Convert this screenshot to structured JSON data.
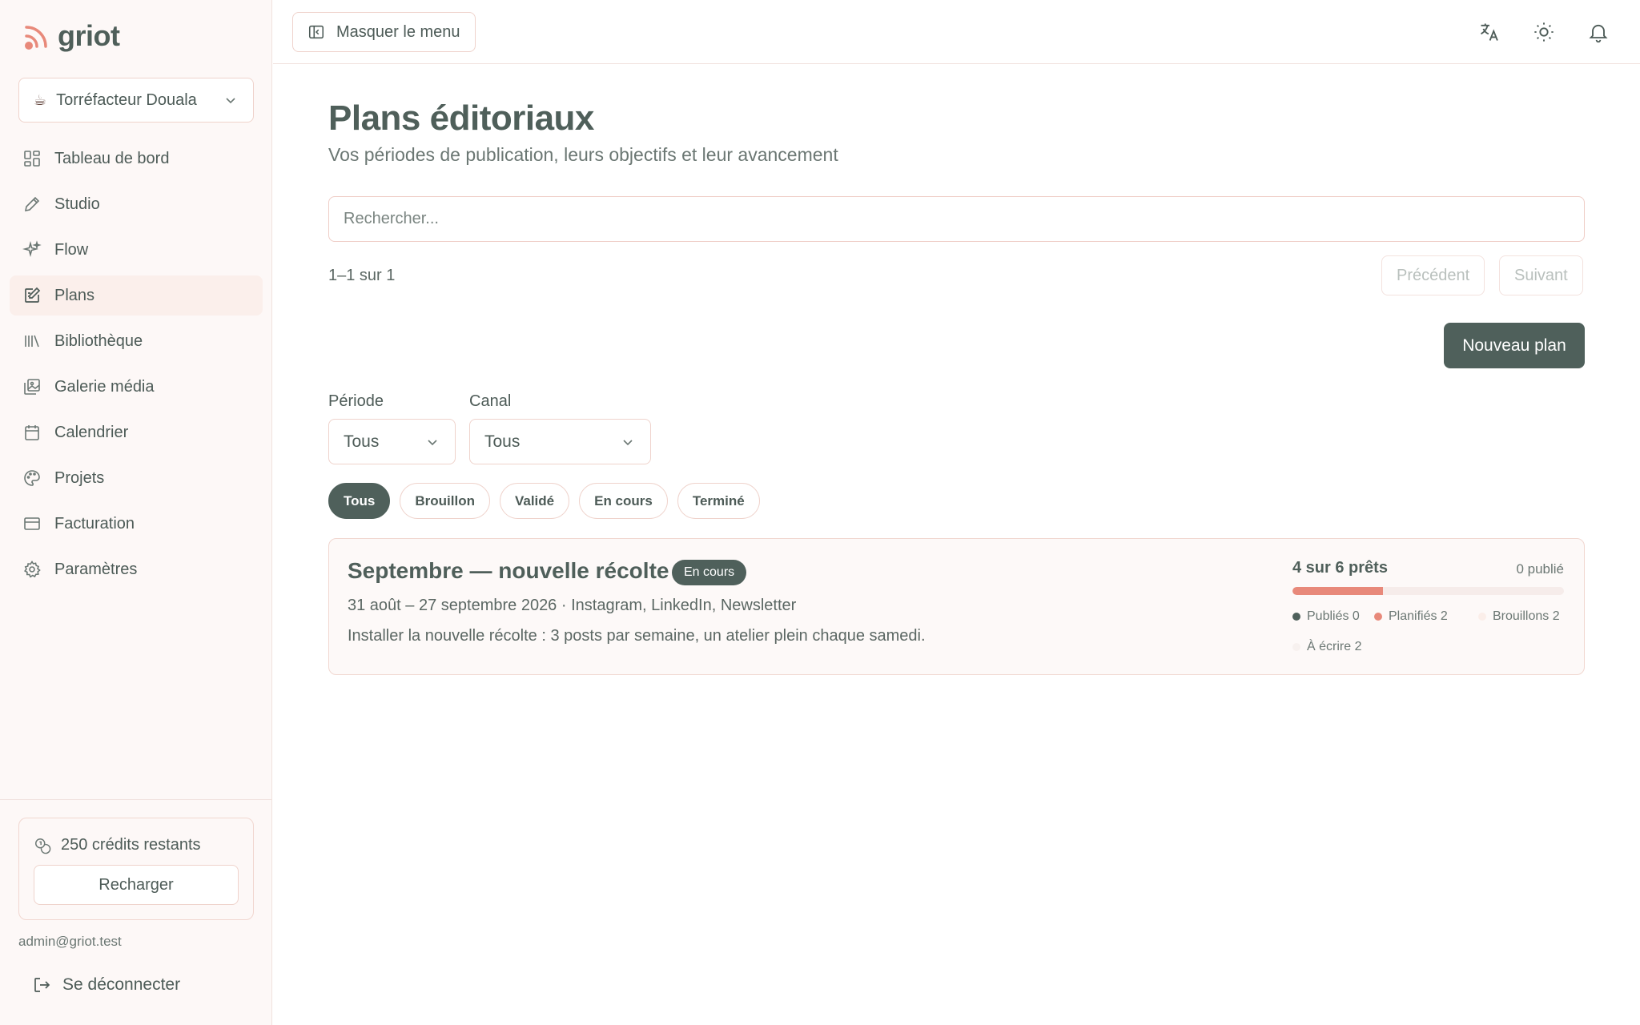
{
  "app": {
    "name": "griot"
  },
  "workspace": {
    "icon": "☕",
    "name": "Torréfacteur Douala"
  },
  "nav": [
    {
      "label": "Tableau de bord",
      "icon": "dashboard-icon"
    },
    {
      "label": "Studio",
      "icon": "pencil-icon"
    },
    {
      "label": "Flow",
      "icon": "sparkles-icon"
    },
    {
      "label": "Plans",
      "icon": "edit-document-icon",
      "active": true
    },
    {
      "label": "Bibliothèque",
      "icon": "library-icon"
    },
    {
      "label": "Galerie média",
      "icon": "gallery-icon"
    },
    {
      "label": "Calendrier",
      "icon": "calendar-icon"
    },
    {
      "label": "Projets",
      "icon": "palette-icon"
    },
    {
      "label": "Facturation",
      "icon": "credit-card-icon"
    },
    {
      "label": "Paramètres",
      "icon": "gear-icon"
    }
  ],
  "credits": {
    "label": "250 crédits restants",
    "button": "Recharger"
  },
  "user": {
    "email": "admin@griot.test",
    "logout": "Se déconnecter"
  },
  "topbar": {
    "hide_menu": "Masquer le menu"
  },
  "page": {
    "title": "Plans éditoriaux",
    "subtitle": "Vos périodes de publication, leurs objectifs et leur avancement"
  },
  "search": {
    "placeholder": "Rechercher..."
  },
  "pagination": {
    "info": "1–1 sur 1",
    "prev": "Précédent",
    "next": "Suivant"
  },
  "actions": {
    "new_plan": "Nouveau plan"
  },
  "filters": {
    "period": {
      "label": "Période",
      "value": "Tous"
    },
    "channel": {
      "label": "Canal",
      "value": "Tous"
    },
    "status_pills": [
      "Tous",
      "Brouillon",
      "Validé",
      "En cours",
      "Terminé"
    ],
    "active_pill": "Tous"
  },
  "plans": [
    {
      "title": "Septembre — nouvelle récolte",
      "status": "En cours",
      "dates": "31 août – 27 septembre 2026 · Instagram, LinkedIn, Newsletter",
      "description": "Installer la nouvelle récolte : 3 posts par semaine, un atelier plein chaque samedi.",
      "progress": {
        "summary": "4 sur 6 prêts",
        "published_label": "0 publié",
        "fraction_filled": 0.333,
        "legend": [
          {
            "label": "Publiés 0",
            "color": "#4f605b"
          },
          {
            "label": "Planifiés 2",
            "color": "#e8897a"
          },
          {
            "label": "Brouillons 2",
            "color": "#fbeee9"
          },
          {
            "label": "À écrire 2",
            "color": "#f7f1ef"
          }
        ]
      }
    }
  ],
  "colors": {
    "accent": "#4f605b",
    "coral": "#e8897a",
    "border": "#efd3cc",
    "sidebar_bg": "#fdf8f7"
  }
}
